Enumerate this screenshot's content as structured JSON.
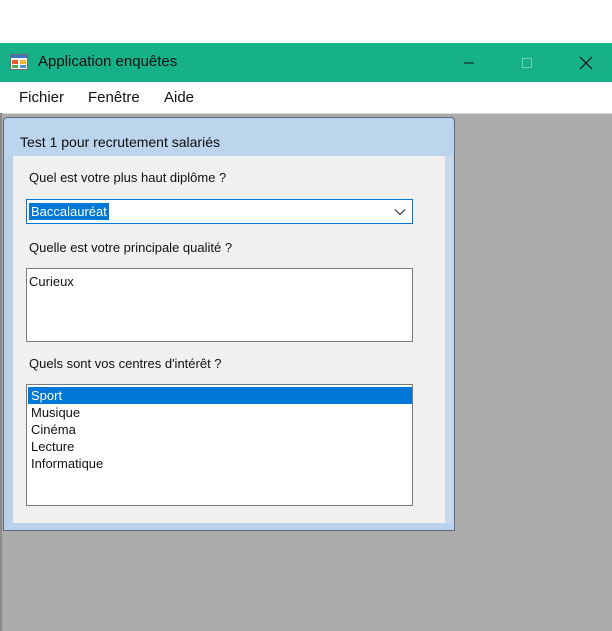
{
  "window": {
    "title": "Application enquêtes",
    "icon": "app-form-icon",
    "controls": {
      "minimize_icon": "minimize-icon",
      "maximize_icon": "maximize-icon",
      "close_icon": "close-icon"
    },
    "colors": {
      "titlebar": "#16b089",
      "mdi_background": "#ababab",
      "selection": "#0078d7"
    }
  },
  "menubar": {
    "items": [
      {
        "label": "Fichier"
      },
      {
        "label": "Fenêtre"
      },
      {
        "label": "Aide"
      }
    ]
  },
  "child_window": {
    "title": "Test 1 pour recrutement salariés",
    "q1": {
      "label": "Quel est votre plus haut diplôme ?",
      "selected": "Baccalauréat",
      "dropdown_icon": "chevron-down-icon"
    },
    "q2": {
      "label": "Quelle est votre principale qualité ?",
      "value": "Curieux"
    },
    "q3": {
      "label": "Quels sont vos centres d'intérêt ?",
      "items": [
        {
          "label": "Sport",
          "selected": true
        },
        {
          "label": "Musique",
          "selected": false
        },
        {
          "label": "Cinéma",
          "selected": false
        },
        {
          "label": "Lecture",
          "selected": false
        },
        {
          "label": "Informatique",
          "selected": false
        }
      ]
    }
  }
}
